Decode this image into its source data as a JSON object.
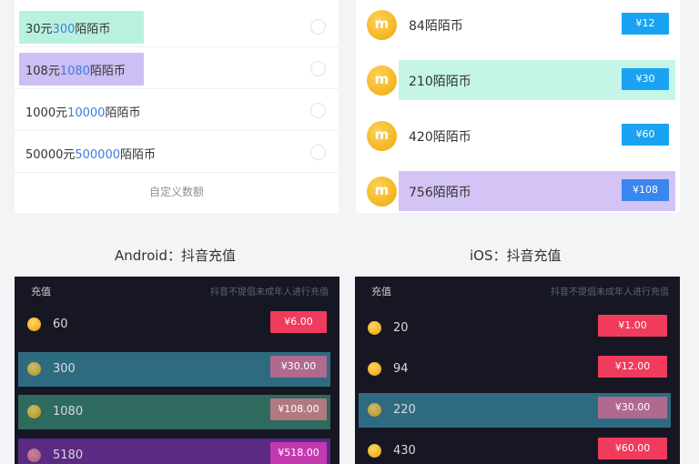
{
  "tl_card": {
    "rows": [
      {
        "prefix": "30元",
        "amount": "300",
        "suffix": "陌陌币",
        "highlight": "#b8f2de"
      },
      {
        "prefix": "108元",
        "amount": "1080",
        "suffix": "陌陌币",
        "highlight": "#cdbff3"
      },
      {
        "prefix": "1000元",
        "amount": "10000",
        "suffix": "陌陌币",
        "highlight": ""
      },
      {
        "prefix": "50000元",
        "amount": "500000",
        "suffix": "陌陌币",
        "highlight": ""
      }
    ],
    "footer": "自定义数额"
  },
  "tr_card": {
    "rows": [
      {
        "label": "84陌陌币",
        "price": "¥12",
        "highlight": ""
      },
      {
        "label": "210陌陌币",
        "price": "¥30",
        "highlight": "#c4f5e6"
      },
      {
        "label": "420陌陌币",
        "price": "¥60",
        "highlight": ""
      },
      {
        "label": "756陌陌币",
        "price": "¥108",
        "highlight": "#d4c4f5"
      }
    ],
    "coin_letter": "m"
  },
  "labels": {
    "android": "Android：抖音充值",
    "ios": "iOS：抖音充值"
  },
  "android": {
    "title": "充值",
    "note": "抖音不提倡未成年人进行充值",
    "rows": [
      {
        "amount": "60",
        "price": "¥6.00",
        "highlight": ""
      },
      {
        "amount": "300",
        "price": "¥30.00",
        "highlight": "#2f6b80"
      },
      {
        "amount": "1080",
        "price": "¥108.00",
        "highlight": "#2e6a5e"
      },
      {
        "amount": "5180",
        "price": "¥518.00",
        "highlight": "#5b2a83"
      }
    ]
  },
  "ios": {
    "title": "充值",
    "note": "抖音不提倡未成年人进行充值",
    "rows": [
      {
        "amount": "20",
        "price": "¥1.00",
        "highlight": ""
      },
      {
        "amount": "94",
        "price": "¥12.00",
        "highlight": ""
      },
      {
        "amount": "220",
        "price": "¥30.00",
        "highlight": "#2f6b80"
      },
      {
        "amount": "430",
        "price": "¥60.00",
        "highlight": ""
      }
    ]
  }
}
